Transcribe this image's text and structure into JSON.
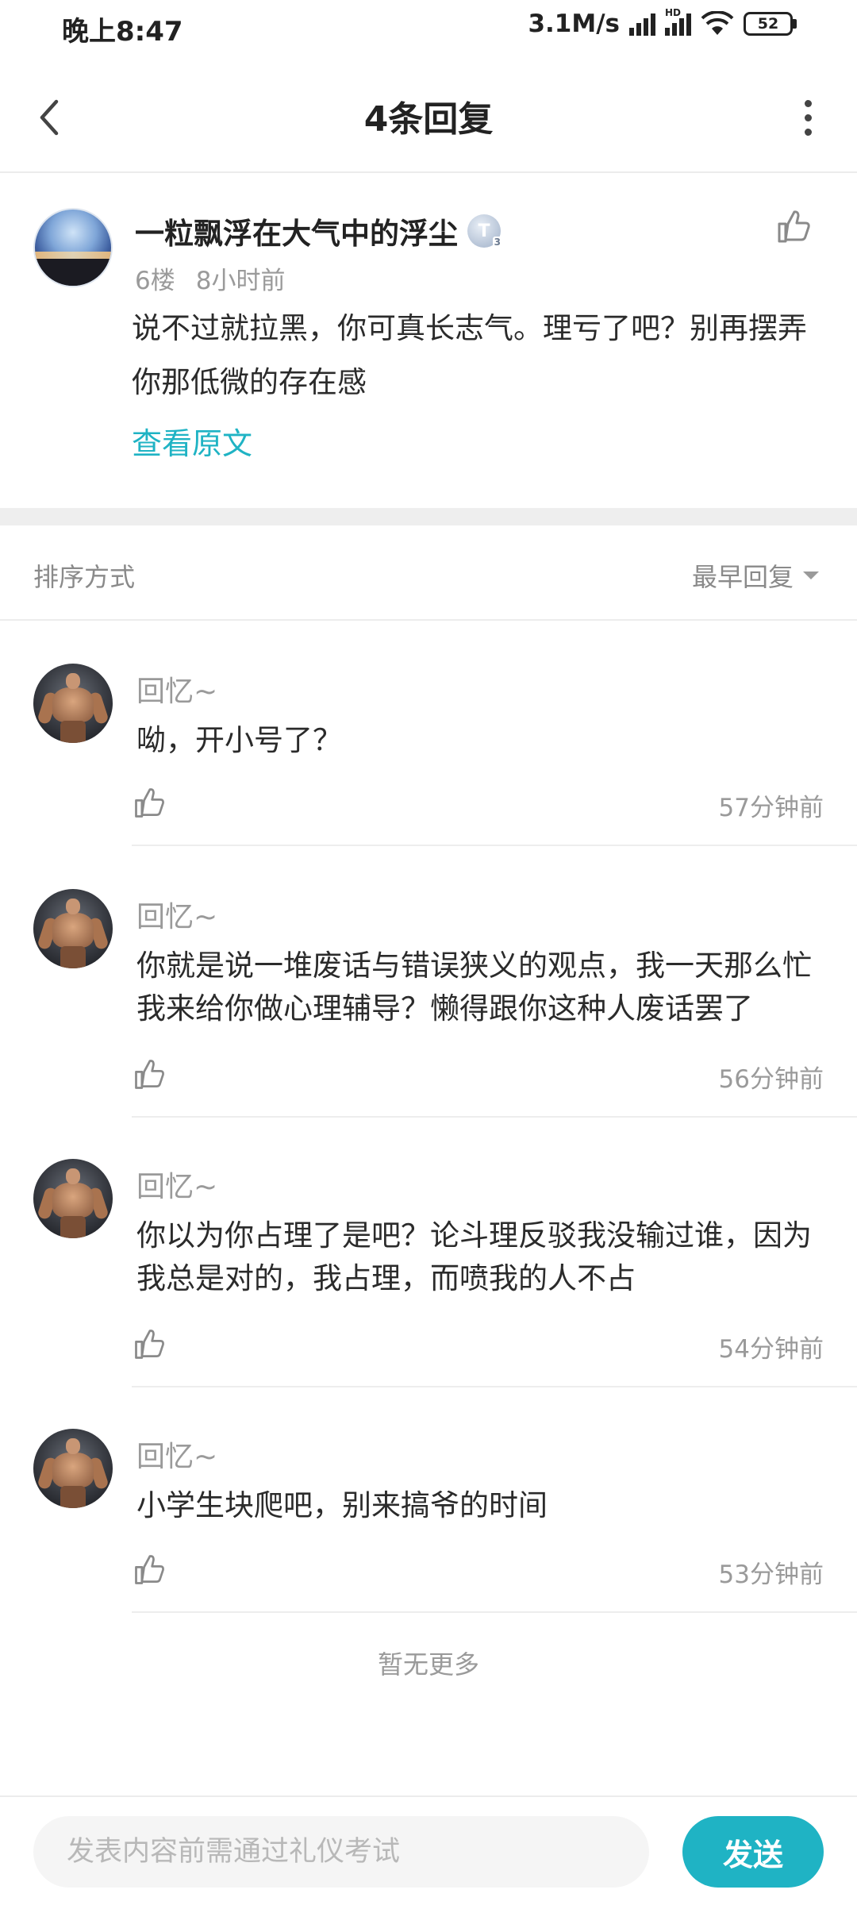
{
  "status_bar": {
    "time": "晚上8:47",
    "net_speed": "3.1M/s",
    "hd_label": "HD",
    "battery": "52"
  },
  "header": {
    "title": "4条回复"
  },
  "post": {
    "author": "一粒飘浮在大气中的浮尘",
    "level_badge": "T",
    "level_sub": "3",
    "floor": "6楼",
    "time": "8小时前",
    "text": "说不过就拉黑，你可真长志气。理亏了吧？别再摆弄你那低微的存在感",
    "view_original": "查看原文"
  },
  "sort": {
    "label": "排序方式",
    "selected": "最早回复"
  },
  "replies": [
    {
      "name": "回忆~",
      "text": "呦，开小号了？",
      "time": "57分钟前"
    },
    {
      "name": "回忆~",
      "text": "你就是说一堆废话与错误狭义的观点，我一天那么忙我来给你做心理辅导？懒得跟你这种人废话罢了",
      "time": "56分钟前"
    },
    {
      "name": "回忆~",
      "text": "你以为你占理了是吧？论斗理反驳我没输过谁，因为我总是对的，我占理，而喷我的人不占",
      "time": "54分钟前"
    },
    {
      "name": "回忆~",
      "text": "小学生块爬吧，别来搞爷的时间",
      "time": "53分钟前"
    }
  ],
  "footer_note": "暂无更多",
  "composer": {
    "placeholder": "发表内容前需通过礼仪考试",
    "send_label": "发送"
  },
  "colors": {
    "accent": "#1fb3c4",
    "muted_text": "#9a9a9a",
    "body_text": "#2b2b2b"
  },
  "icons": [
    "back-arrow-icon",
    "more-vertical-icon",
    "thumbs-up-icon",
    "signal-icon",
    "wifi-icon",
    "battery-icon",
    "dropdown-triangle-icon"
  ]
}
